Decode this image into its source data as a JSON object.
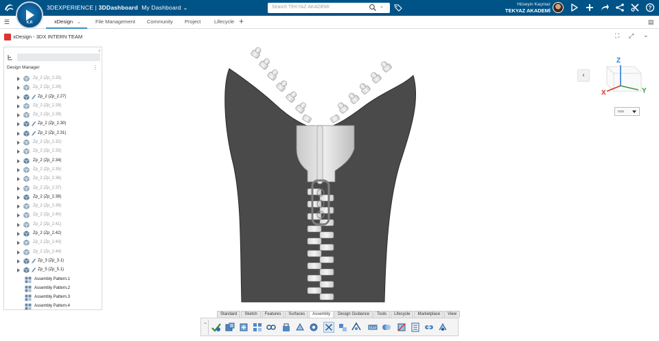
{
  "topbar": {
    "brand_prefix": "3DEXPERIENCE | ",
    "brand_app": "3DDashboard",
    "dashboard": "My Dashboard",
    "compass_label": "K,R",
    "search_placeholder": "Search TEKYAZ AKADEMI",
    "user_name": "Hüseyin Kaçmaz",
    "company": "TEKYAZ AKADEMİ",
    "colors": {
      "bar": "#005386"
    }
  },
  "tabs": [
    {
      "label": "xDesign",
      "active": true
    },
    {
      "label": "File Management"
    },
    {
      "label": "Community"
    },
    {
      "label": "Project"
    },
    {
      "label": "Lifecycle"
    }
  ],
  "window": {
    "title": "xDesign - 3DX INTERN TEAM"
  },
  "panel": {
    "header": "Design Manager",
    "items": [
      {
        "label": "Zp_2 (Zp_2.25)",
        "loaded": false,
        "linked": false
      },
      {
        "label": "Zp_2 (Zp_2.26)",
        "loaded": false,
        "linked": false
      },
      {
        "label": "Zp_2 (Zp_2.27)",
        "loaded": true,
        "linked": true
      },
      {
        "label": "Zp_2 (Zp_2.28)",
        "loaded": false,
        "linked": false
      },
      {
        "label": "Zp_2 (Zp_2.29)",
        "loaded": false,
        "linked": false
      },
      {
        "label": "Zp_2 (Zp_2.30)",
        "loaded": true,
        "linked": true
      },
      {
        "label": "Zp_2 (Zp_2.31)",
        "loaded": true,
        "linked": true
      },
      {
        "label": "Zp_2 (Zp_2.32)",
        "loaded": false,
        "linked": false
      },
      {
        "label": "Zp_2 (Zp_2.33)",
        "loaded": false,
        "linked": false
      },
      {
        "label": "Zp_2 (Zp_2.34)",
        "loaded": true,
        "linked": false
      },
      {
        "label": "Zp_2 (Zp_2.35)",
        "loaded": false,
        "linked": false
      },
      {
        "label": "Zp_2 (Zp_2.36)",
        "loaded": false,
        "linked": false
      },
      {
        "label": "Zp_2 (Zp_2.37)",
        "loaded": false,
        "linked": false
      },
      {
        "label": "Zp_2 (Zp_2.38)",
        "loaded": true,
        "linked": false
      },
      {
        "label": "Zp_2 (Zp_2.39)",
        "loaded": false,
        "linked": false
      },
      {
        "label": "Zp_2 (Zp_2.40)",
        "loaded": false,
        "linked": false
      },
      {
        "label": "Zp_2 (Zp_2.41)",
        "loaded": false,
        "linked": false
      },
      {
        "label": "Zp_2 (Zp_2.42)",
        "loaded": true,
        "linked": false
      },
      {
        "label": "Zp_2 (Zp_2.43)",
        "loaded": false,
        "linked": false
      },
      {
        "label": "Zp_2 (Zp_2.44)",
        "loaded": false,
        "linked": false
      },
      {
        "label": "Zp_3 (Zp_3.1)",
        "loaded": true,
        "linked": true
      },
      {
        "label": "Zp_5 (Zp_5.1)",
        "loaded": true,
        "linked": true
      }
    ],
    "patterns": [
      "Assembly Pattern.1",
      "Assembly Pattern.2",
      "Assembly Pattern.3",
      "Assembly Pattern.4"
    ]
  },
  "compass3d": {
    "x": "X",
    "y": "Y",
    "z": "Z"
  },
  "units": {
    "value": "mm"
  },
  "action_bar": {
    "tabs": [
      "Standard",
      "Sketch",
      "Features",
      "Surfaces",
      "Assembly",
      "Design Guidance",
      "Tools",
      "Lifecycle",
      "Marketplace",
      "View"
    ],
    "active": "Assembly"
  }
}
